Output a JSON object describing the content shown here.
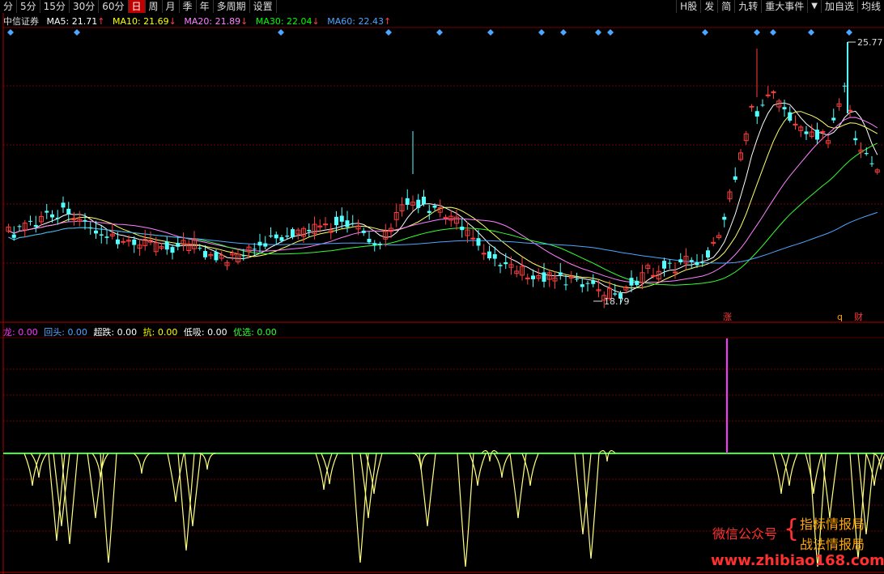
{
  "toolbar": {
    "items": [
      "分",
      "5分",
      "15分",
      "30分",
      "60分",
      "日",
      "周",
      "月",
      "季",
      "年",
      "多周期",
      "设置"
    ],
    "active": "日",
    "right_items": [
      "H股",
      "发",
      "简",
      "九转",
      "重大事件"
    ],
    "dropdown": "▼",
    "add_watch": "加自选",
    "avg_line": "均线"
  },
  "main_legend": {
    "name": "中信证券",
    "ma5": {
      "label": "MA5:",
      "value": "21.71",
      "arrow": "↑",
      "color": "#ffffff"
    },
    "ma10": {
      "label": "MA10:",
      "value": "21.69",
      "arrow": "↓",
      "color": "#ffff00"
    },
    "ma20": {
      "label": "MA20:",
      "value": "21.89",
      "arrow": "↓",
      "color": "#ff80ff"
    },
    "ma30": {
      "label": "MA30:",
      "value": "22.04",
      "arrow": "↓",
      "color": "#00ff00"
    },
    "ma60": {
      "label": "MA60:",
      "value": "22.43",
      "arrow": "↑",
      "color": "#4da6ff"
    }
  },
  "price_labels": {
    "high": "25.77",
    "low": "18.79"
  },
  "markers": {
    "zhang": "涨",
    "q": "q",
    "cai": "财"
  },
  "sub_legend": [
    {
      "label": "龙:",
      "value": "0.00",
      "color": "#ff33ff"
    },
    {
      "label": "回头:",
      "value": "0.00",
      "color": "#4da6ff"
    },
    {
      "label": "超跌:",
      "value": "0.00",
      "color": "#ffffff"
    },
    {
      "label": "抗:",
      "value": "0.00",
      "color": "#ffff00"
    },
    {
      "label": "低吸:",
      "value": "0.00",
      "color": "#ffffff"
    },
    {
      "label": "优选:",
      "value": "0.00",
      "color": "#33ff33"
    }
  ],
  "watermark": {
    "wechat": "微信公众号",
    "brace": "{",
    "line1": "指标情报局",
    "line2": "战法情报局",
    "url": "www.zhibiao168.com"
  },
  "colors": {
    "up": "#ff3c3c",
    "down": "#54ffff",
    "grid": "#7a0000",
    "zero": "#33ff33",
    "spike": "#ff33ff",
    "bars": "#ffff80"
  }
}
